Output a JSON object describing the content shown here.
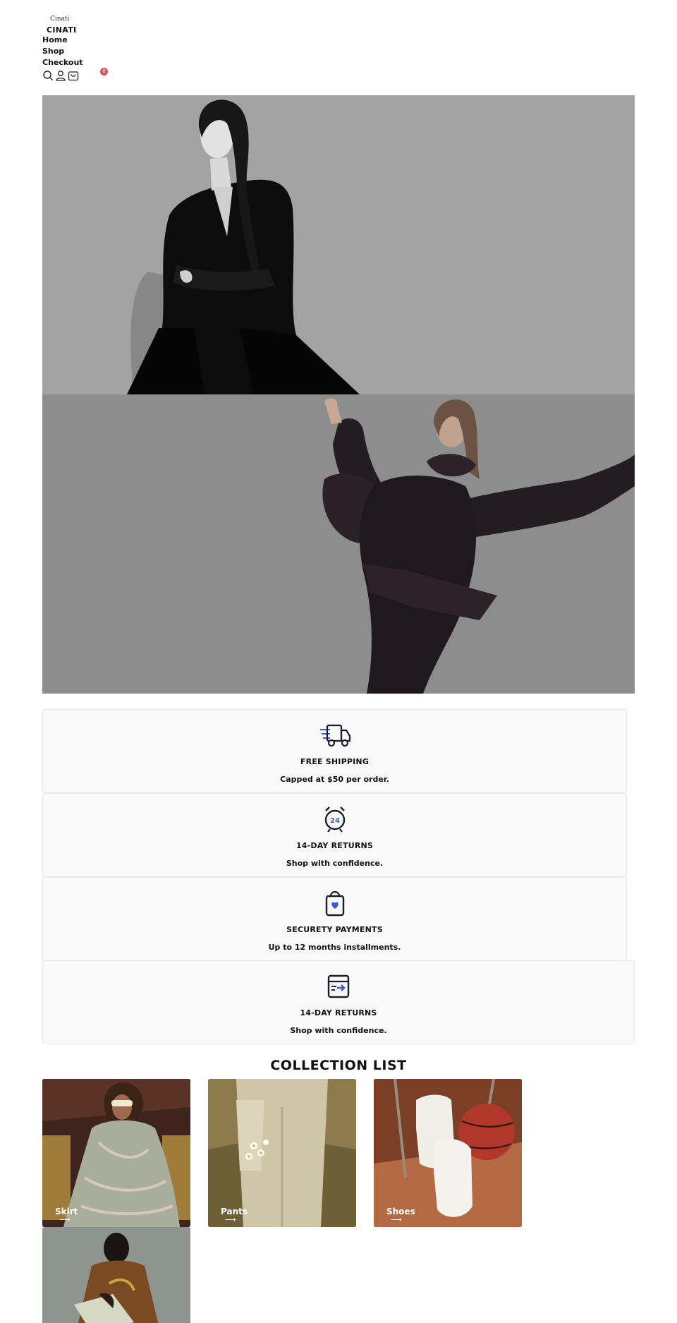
{
  "header": {
    "logo_image_text": "Cinati",
    "logo_text": "CINATI",
    "nav": [
      "Home",
      "Shop",
      "Checkout"
    ],
    "icons": [
      "search-icon",
      "user-icon",
      "cart-icon"
    ],
    "cart_count": "0",
    "badge_color": "#e04f4f"
  },
  "features": [
    {
      "icon": "truck-icon",
      "title": "FREE SHIPPING",
      "subtitle": "Capped at $50 per order."
    },
    {
      "icon": "alarm-clock-icon",
      "title": "14-DAY RETURNS",
      "subtitle": "Shop with confidence."
    },
    {
      "icon": "shopping-bag-icon",
      "title": "SECURETY PAYMENTS",
      "subtitle": "Up to 12 months installments."
    },
    {
      "icon": "box-return-icon",
      "title": "14-DAY RETURNS",
      "subtitle": "Shop with confidence."
    }
  ],
  "clock_number": "24",
  "collection": {
    "title": "COLLECTION LIST",
    "items": [
      {
        "label": "Skirt",
        "arrow": "⟶"
      },
      {
        "label": "Pants",
        "arrow": "⟶"
      },
      {
        "label": "Shoes",
        "arrow": "⟶"
      },
      {
        "label": "",
        "arrow": ""
      }
    ]
  },
  "colors": {
    "accent": "#3b5bdb",
    "icon_stroke": "#1c1c2a",
    "feature_bg": "#f9f9f9"
  }
}
